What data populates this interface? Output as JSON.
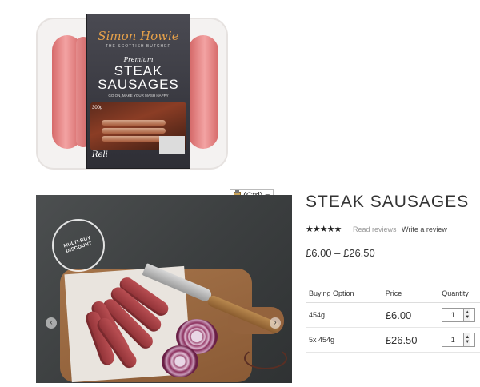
{
  "packaging": {
    "brand": "Simon Howie",
    "brand_sub": "THE SCOTTISH BUTCHER",
    "premium": "Premium",
    "title_line1": "STEAK",
    "title_line2": "SAUSAGES",
    "tagline": "GO ON, MAKE YOUR MASH HAPPY",
    "weight": "300g",
    "reli": "Reli"
  },
  "photo": {
    "stamp_text": "MULTI-BUY DISCOUNT",
    "prev_glyph": "‹",
    "next_glyph": "›"
  },
  "paste_options": {
    "label": "(Ctrl)",
    "arrow": "▾"
  },
  "product": {
    "title": "STEAK SAUSAGES",
    "rating": 5,
    "stars_glyphs": "★★★★★",
    "read_reviews": "Read reviews",
    "write_review": "Write a review",
    "price_range": "£6.00 – £26.50"
  },
  "options_table": {
    "headers": [
      "Buying Option",
      "Price",
      "Quantity"
    ],
    "rows": [
      {
        "option": "454g",
        "price": "£6.00",
        "quantity": "1"
      },
      {
        "option": "5x 454g",
        "price": "£26.50",
        "quantity": "1"
      }
    ]
  }
}
